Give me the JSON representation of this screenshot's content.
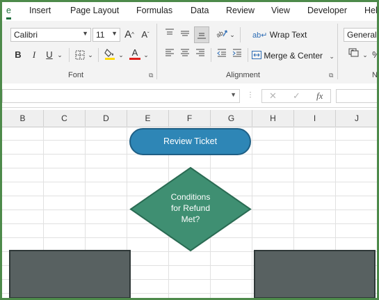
{
  "tabs": [
    "e",
    "Insert",
    "Page Layout",
    "Formulas",
    "Data",
    "Review",
    "View",
    "Developer",
    "Help"
  ],
  "font": {
    "name": "Calibri",
    "size": "11",
    "grow_label": "A",
    "shrink_label": "A",
    "bold": "B",
    "italic": "I",
    "underline": "U",
    "font_color_label": "A",
    "group_label": "Font",
    "highlight_color": "#ffd900",
    "font_color": "#e0201b"
  },
  "alignment": {
    "wrap_text": "Wrap Text",
    "merge_center": "Merge & Center",
    "group_label": "Alignment"
  },
  "number": {
    "format": "General",
    "group_label": "Nu"
  },
  "formula_bar": {
    "cancel": "✕",
    "enter": "✓",
    "fx": "fx"
  },
  "columns": [
    "B",
    "C",
    "D",
    "E",
    "F",
    "G",
    "H",
    "I",
    "J"
  ],
  "flowchart": {
    "start_label": "Review Ticket",
    "decision_line1": "Conditions",
    "decision_line2": "for Refund",
    "decision_line3": "Met?"
  },
  "colors": {
    "active_tab": "#1e6e3c",
    "frame": "#4d8a4a",
    "terminator": "#2e86b6",
    "decision": "#3f8f72",
    "process": "#586161"
  }
}
